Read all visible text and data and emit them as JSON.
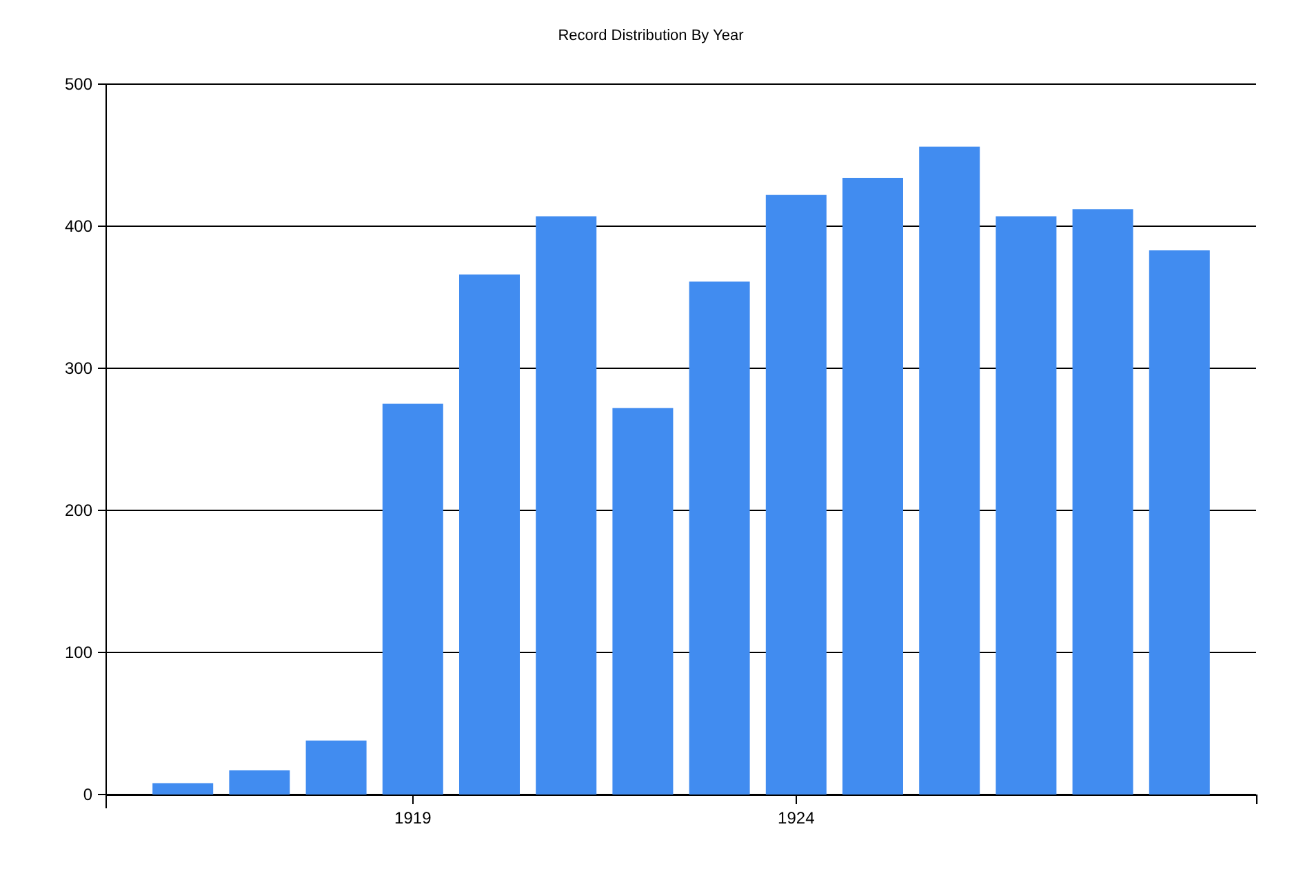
{
  "chart_data": {
    "type": "bar",
    "title": "Record Distribution By Year",
    "x": [
      1916,
      1917,
      1918,
      1919,
      1920,
      1921,
      1922,
      1923,
      1924,
      1925,
      1926,
      1927,
      1928,
      1929
    ],
    "series": [
      {
        "color": "#418cf0",
        "values": [
          8,
          17,
          38,
          275,
          366,
          407,
          272,
          361,
          422,
          434,
          456,
          407,
          412,
          383
        ]
      }
    ],
    "xlim": [
      1915,
      1930
    ],
    "ylim": [
      0,
      500
    ],
    "grid": true,
    "xticks": [
      1919,
      1924
    ],
    "yticks": [
      0,
      100,
      200,
      300,
      400,
      500
    ]
  }
}
